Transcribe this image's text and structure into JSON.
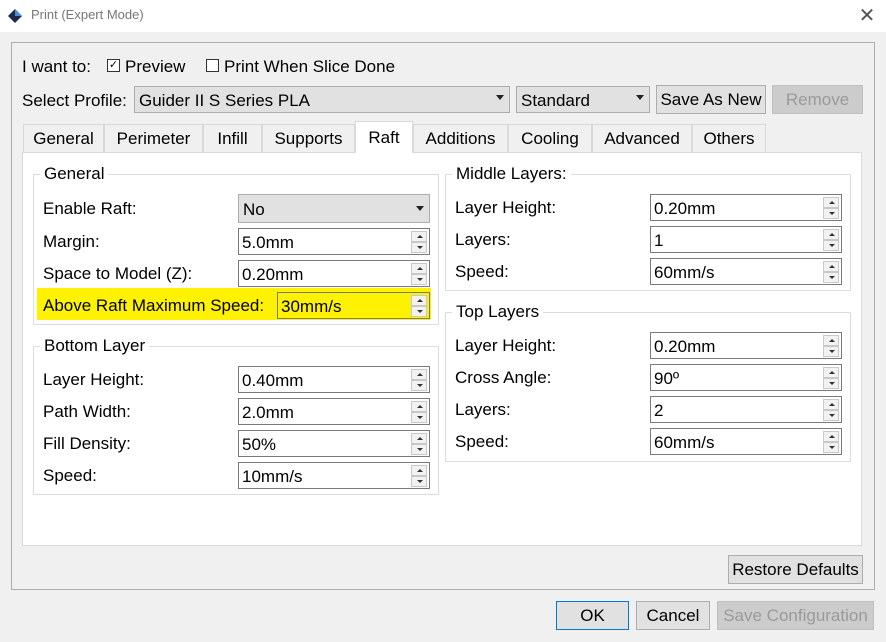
{
  "window": {
    "title": "Print (Expert Mode)",
    "close_glyph": "✕",
    "icon": "app-logo-icon"
  },
  "mode": {
    "label": "I want to:",
    "preview_label": "Preview",
    "preview_checked": true,
    "print_when_done_label": "Print When Slice Done",
    "print_when_done_checked": false
  },
  "profile": {
    "label": "Select Profile:",
    "selected": "Guider II S Series PLA",
    "quality": "Standard",
    "save_as_new": "Save As New",
    "remove": "Remove"
  },
  "tabs": [
    "General",
    "Perimeter",
    "Infill",
    "Supports",
    "Raft",
    "Additions",
    "Cooling",
    "Advanced",
    "Others"
  ],
  "active_tab": "Raft",
  "raft": {
    "general": {
      "title": "General",
      "enable_raft": {
        "label": "Enable Raft:",
        "value": "No"
      },
      "margin": {
        "label": "Margin:",
        "value": "5.0mm"
      },
      "space_to_model": {
        "label": "Space to Model (Z):",
        "value": "0.20mm"
      },
      "above_raft_speed": {
        "label": "Above Raft Maximum Speed:",
        "value": "30mm/s"
      }
    },
    "bottom_layer": {
      "title": "Bottom Layer",
      "layer_height": {
        "label": "Layer Height:",
        "value": "0.40mm"
      },
      "path_width": {
        "label": "Path Width:",
        "value": "2.0mm"
      },
      "fill_density": {
        "label": "Fill Density:",
        "value": "50%"
      },
      "speed": {
        "label": "Speed:",
        "value": "10mm/s"
      }
    },
    "middle_layers": {
      "title": "Middle Layers:",
      "layer_height": {
        "label": "Layer Height:",
        "value": "0.20mm"
      },
      "layers": {
        "label": "Layers:",
        "value": "1"
      },
      "speed": {
        "label": "Speed:",
        "value": "60mm/s"
      }
    },
    "top_layers": {
      "title": "Top Layers",
      "layer_height": {
        "label": "Layer Height:",
        "value": "0.20mm"
      },
      "cross_angle": {
        "label": "Cross Angle:",
        "value": "90º"
      },
      "layers": {
        "label": "Layers:",
        "value": "2"
      },
      "speed": {
        "label": "Speed:",
        "value": "60mm/s"
      }
    }
  },
  "footer": {
    "restore_defaults": "Restore Defaults",
    "ok": "OK",
    "cancel": "Cancel",
    "save_configuration": "Save Configuration"
  },
  "colors": {
    "highlight": "#fff200",
    "focus_border": "#0078d7"
  }
}
